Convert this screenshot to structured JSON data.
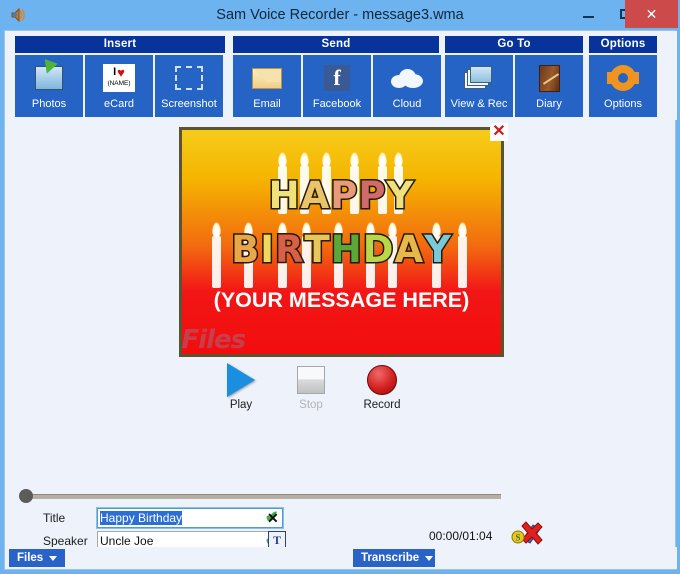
{
  "window": {
    "title": "Sam Voice Recorder - message3.wma",
    "app_icon": "speaker-icon",
    "minimize_label": "–",
    "maximize_label": "□",
    "close_label": "✕"
  },
  "ribbon": {
    "groups": [
      {
        "name": "Insert",
        "label": "Insert",
        "buttons": [
          {
            "label": "Photos",
            "icon": "photos-icon"
          },
          {
            "label": "eCard",
            "icon": "ecard-icon",
            "icon_text_top": "I",
            "icon_heart": "♥",
            "icon_text_bottom": "(NAME)"
          },
          {
            "label": "Screenshot",
            "icon": "screenshot-icon"
          }
        ]
      },
      {
        "name": "Send",
        "label": "Send",
        "buttons": [
          {
            "label": "Email",
            "icon": "email-icon"
          },
          {
            "label": "Facebook",
            "icon": "facebook-icon",
            "icon_glyph": "f"
          },
          {
            "label": "Cloud",
            "icon": "cloud-icon"
          }
        ]
      },
      {
        "name": "Go To",
        "label": "Go To",
        "buttons": [
          {
            "label": "View & Rec",
            "icon": "photo-stack-icon"
          },
          {
            "label": "Diary",
            "icon": "diary-book-icon"
          }
        ]
      },
      {
        "name": "Options",
        "label": "Options",
        "buttons": [
          {
            "label": "Options",
            "icon": "gear-icon"
          }
        ]
      }
    ]
  },
  "card": {
    "title_line1": "HAPPY",
    "title_line2": "BIRTHDAY",
    "message": "(YOUR MESSAGE HERE)",
    "close_label": "✕",
    "watermark": "SnapFiles",
    "title1_letters": [
      {
        "ch": "H",
        "color": "#f0e27a"
      },
      {
        "ch": "A",
        "color": "#e8c46a"
      },
      {
        "ch": "P",
        "color": "#e89a7a"
      },
      {
        "ch": "P",
        "color": "#d16a6a"
      },
      {
        "ch": "Y",
        "color": "#f0e27a"
      }
    ],
    "title2_letters": [
      {
        "ch": "B",
        "color": "#e8a84a"
      },
      {
        "ch": "I",
        "color": "#f0d85a"
      },
      {
        "ch": "R",
        "color": "#d8604a"
      },
      {
        "ch": "T",
        "color": "#e8c65a"
      },
      {
        "ch": "H",
        "color": "#5aa83a"
      },
      {
        "ch": "D",
        "color": "#b8d84a"
      },
      {
        "ch": "A",
        "color": "#e8b84a"
      },
      {
        "ch": "Y",
        "color": "#7ac8d8"
      }
    ]
  },
  "transport": {
    "play_label": "Play",
    "stop_label": "Stop",
    "record_label": "Record",
    "stop_enabled": false
  },
  "seek": {
    "position_percent": 0
  },
  "fields": {
    "title_label": "Title",
    "title_value": "Happy Birthday",
    "title_selected": true,
    "title_ok": "✔",
    "title_clear": "✕",
    "speaker_label": "Speaker",
    "speaker_value": "Uncle Joe",
    "speaker_ok": "✔",
    "speaker_transcribe_icon": "text-tool-icon",
    "timecode": "00:00/01:04",
    "delete_icon": "delete-recording-icon"
  },
  "statusbar": {
    "files_label": "Files",
    "transcribe_label": "Transcribe"
  },
  "colors": {
    "titlebar": "#6cb3ef",
    "ribbon_group_header": "#07339b",
    "ribbon_button": "#2563c4",
    "close_button": "#cc4a4a",
    "status_button": "#2963c8",
    "client_bg": "#eef3fb"
  }
}
